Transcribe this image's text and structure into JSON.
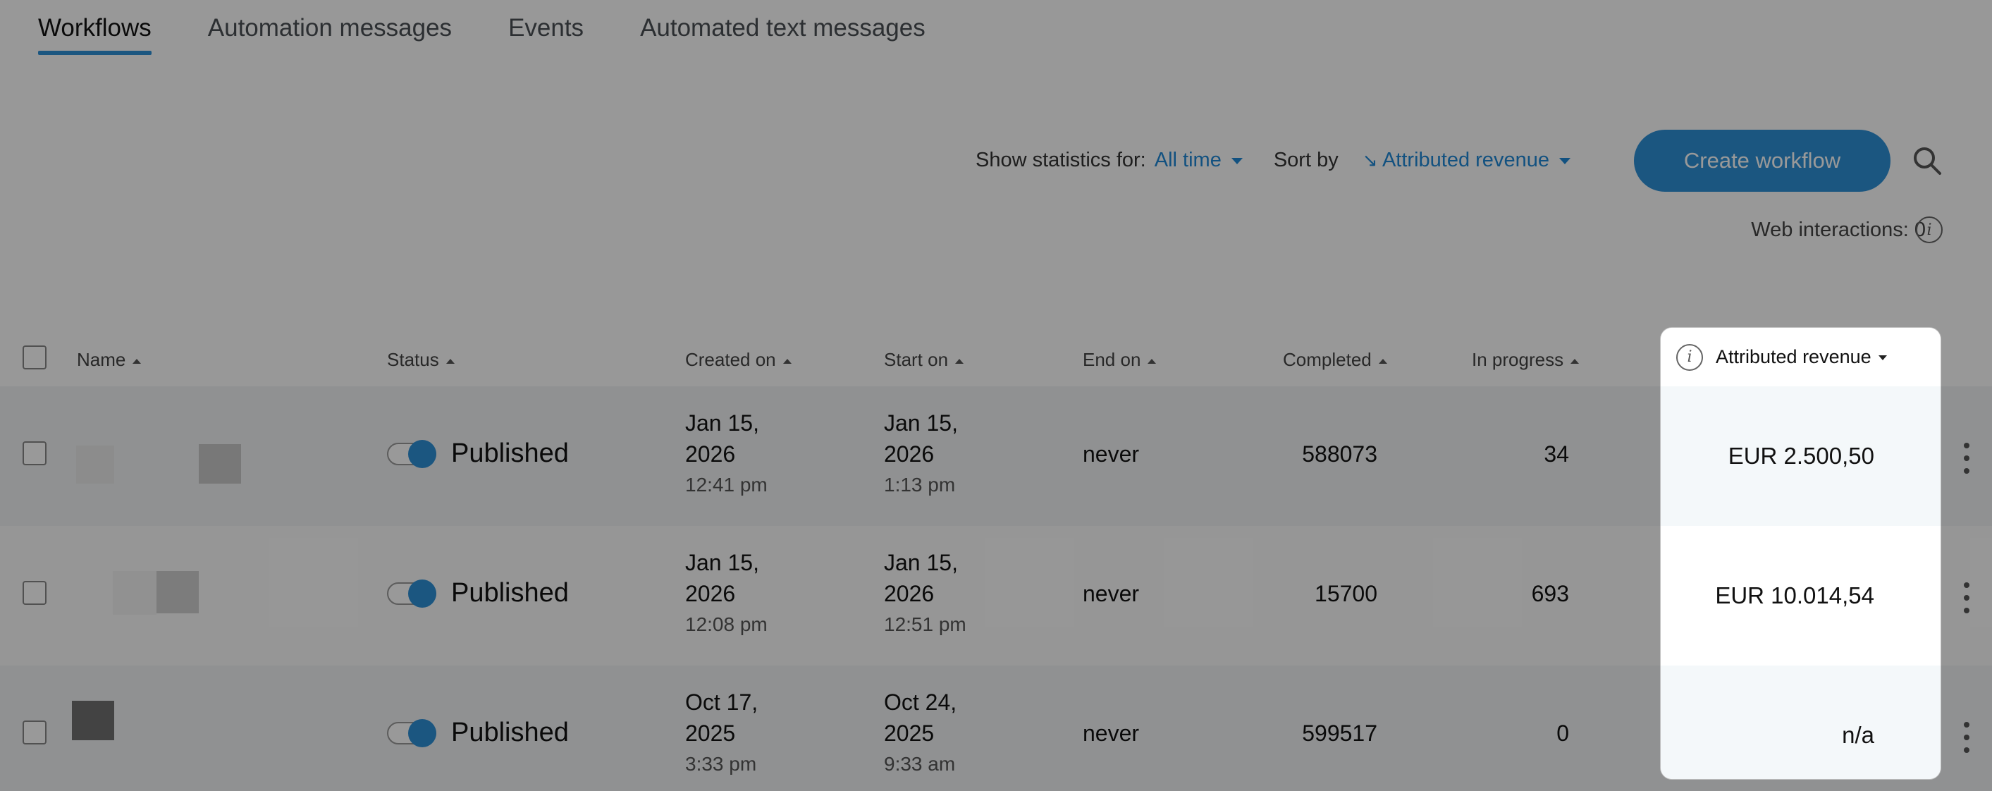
{
  "tabs": [
    {
      "label": "Workflows",
      "active": true
    },
    {
      "label": "Automation messages",
      "active": false
    },
    {
      "label": "Events",
      "active": false
    },
    {
      "label": "Automated text messages",
      "active": false
    }
  ],
  "toolbar": {
    "stats_label": "Show statistics for:",
    "stats_value": "All time",
    "sort_label": "Sort by",
    "sort_value": "Attributed revenue",
    "create_label": "Create workflow"
  },
  "web_interactions": "Web interactions: 0",
  "table": {
    "headers": {
      "name": "Name",
      "status": "Status",
      "created": "Created on",
      "start": "Start on",
      "end": "End on",
      "completed": "Completed",
      "in_progress": "In progress",
      "revenue": "Attributed revenue"
    },
    "rows": [
      {
        "status": "Published",
        "created_date": "Jan 15,",
        "created_year": "2026",
        "created_time": "12:41 pm",
        "start_date": "Jan 15,",
        "start_year": "2026",
        "start_time": "1:13 pm",
        "end": "never",
        "completed": "588073",
        "in_progress": "34",
        "revenue": "EUR 2.500,50"
      },
      {
        "status": "Published",
        "created_date": "Jan 15,",
        "created_year": "2026",
        "created_time": "12:08 pm",
        "start_date": "Jan 15,",
        "start_year": "2026",
        "start_time": "12:51 pm",
        "end": "never",
        "completed": "15700",
        "in_progress": "693",
        "revenue": "EUR 10.014,54"
      },
      {
        "status": "Published",
        "created_date": "Oct 17,",
        "created_year": "2025",
        "created_time": "3:33 pm",
        "start_date": "Oct 24,",
        "start_year": "2025",
        "start_time": "9:33 am",
        "end": "never",
        "completed": "599517",
        "in_progress": "0",
        "revenue": "n/a"
      }
    ]
  },
  "colors": {
    "accent": "#2d8fd5",
    "link": "#1e88d6"
  }
}
